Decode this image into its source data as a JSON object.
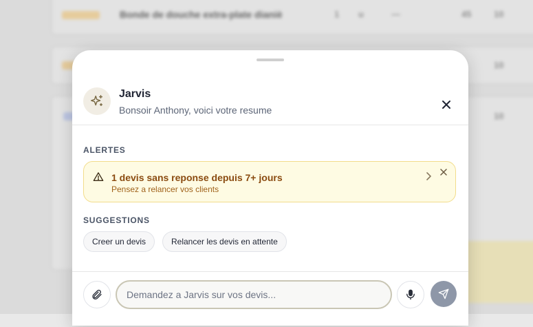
{
  "background": {
    "rows": [
      {
        "badge": "Facturé",
        "text": "Bonde de douche extra-plate dianiè"
      }
    ]
  },
  "assistant": {
    "name": "Jarvis",
    "greeting": "Bonsoir Anthony, voici votre resume",
    "avatar_icon": "sparkles-icon"
  },
  "alerts": {
    "heading": "ALERTES",
    "items": [
      {
        "title": "1 devis sans reponse depuis 7+ jours",
        "subtitle": "Pensez a relancer vos clients",
        "icon": "warning-triangle-icon"
      }
    ]
  },
  "suggestions": {
    "heading": "SUGGESTIONS",
    "items": [
      "Creer un devis",
      "Relancer les devis en attente"
    ]
  },
  "composer": {
    "placeholder": "Demandez a Jarvis sur vos devis...",
    "value": ""
  },
  "colors": {
    "alert_bg": "#fefbe3",
    "alert_border": "#f2dc8a",
    "alert_text": "#8a4b10",
    "send_button": "#8e97a8",
    "avatar_bg": "#f1ede4"
  }
}
